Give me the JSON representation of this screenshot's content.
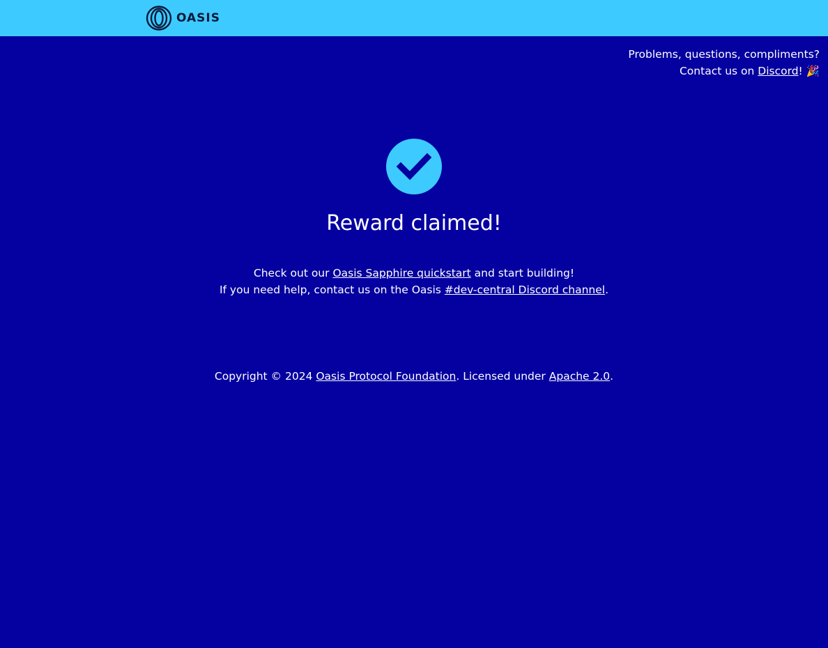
{
  "header": {
    "logo_text": "OASIS",
    "logo_icon": "oasis-ring-logo",
    "background_color": "#3dcbff"
  },
  "contact": {
    "line1": "Problems, questions, compliments?",
    "line2_prefix": "Contact us on ",
    "discord_link": "Discord",
    "line2_suffix": "! 🎉"
  },
  "main": {
    "status_icon": "check-circle-icon",
    "title": "Reward claimed!",
    "line1_prefix": "Check out our ",
    "line1_link": "Oasis Sapphire quickstart",
    "line1_suffix": " and start building!",
    "line2_prefix": "If you need help, contact us on the Oasis ",
    "line2_link": "#dev-central Discord channel",
    "line2_suffix": "."
  },
  "footer": {
    "prefix": "Copyright © 2024 ",
    "foundation_link": "Oasis Protocol Foundation",
    "middle": ". Licensed under ",
    "license_link": "Apache 2.0",
    "suffix": "."
  },
  "colors": {
    "page_background": "#0500a0",
    "accent": "#3dcbff",
    "text": "#ffffff"
  }
}
